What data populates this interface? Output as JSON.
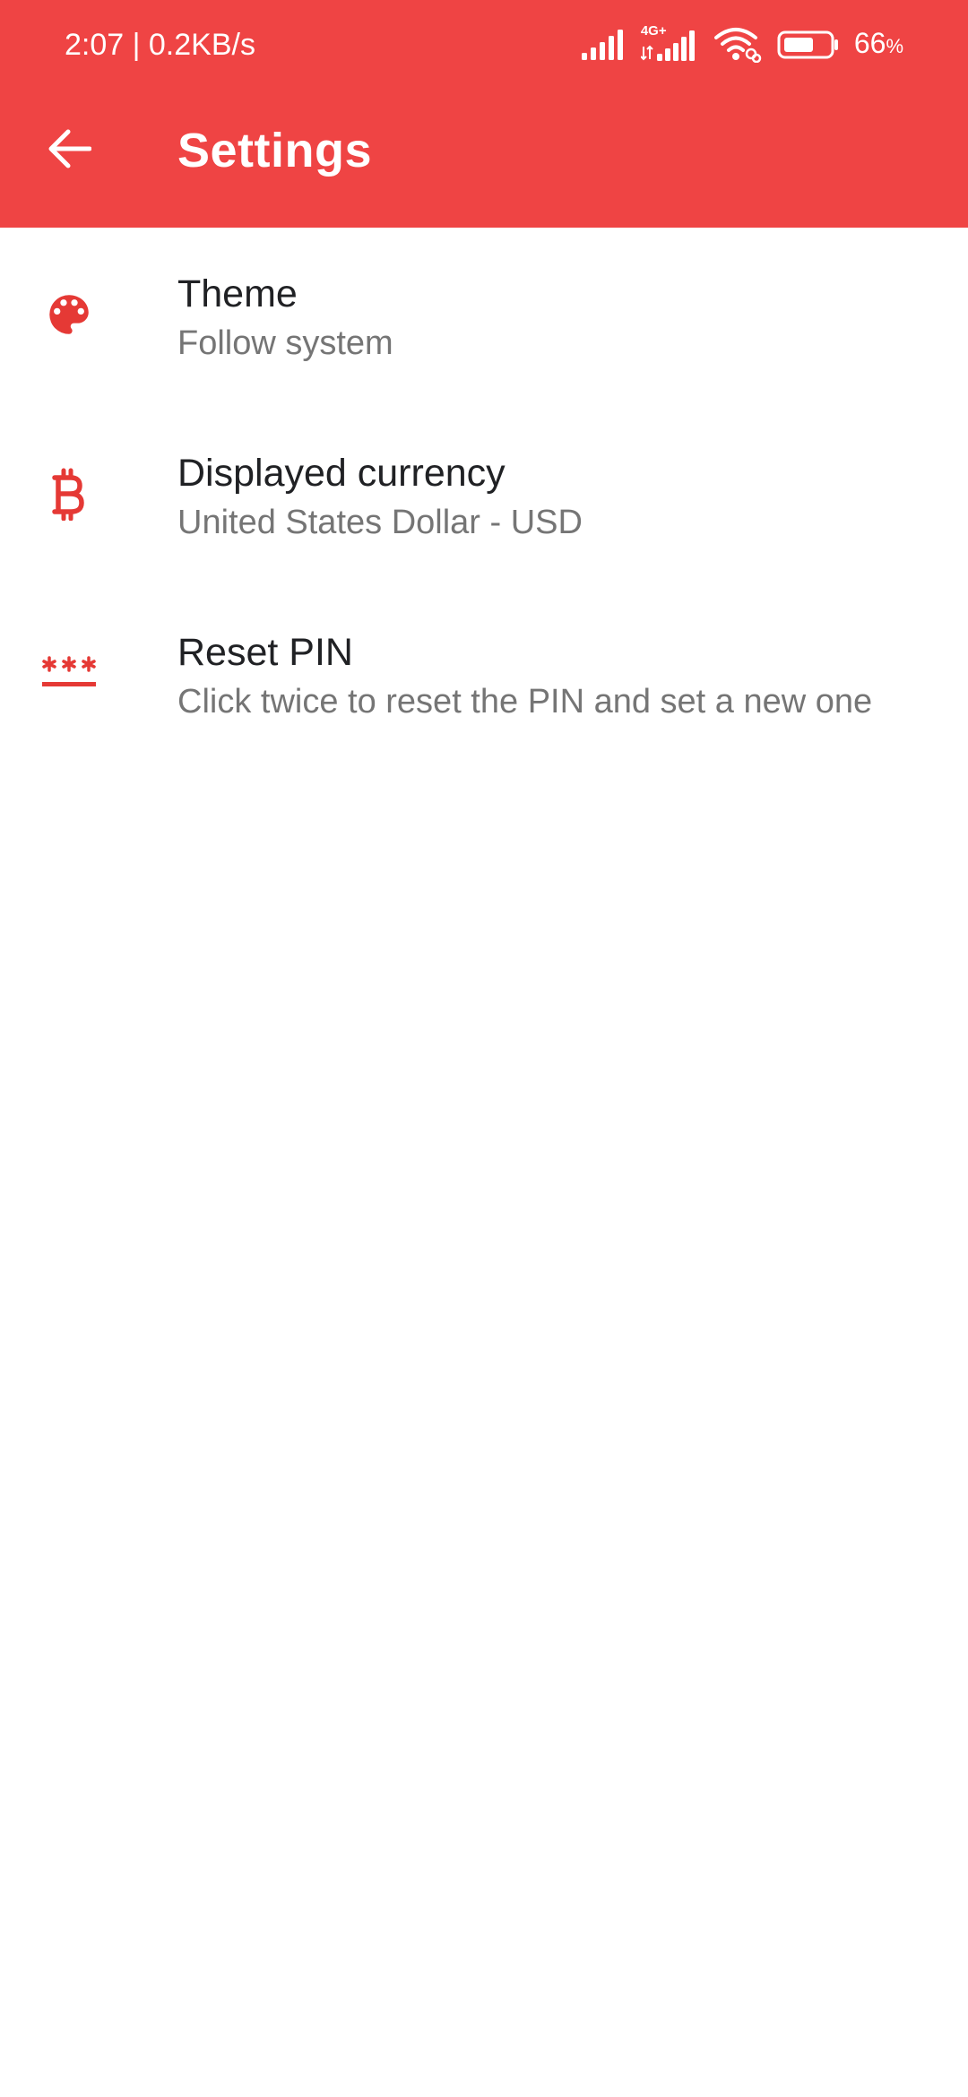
{
  "status_bar": {
    "time_speed": "2:07 | 0.2KB/s",
    "network_type": "4G+",
    "battery_level": 66,
    "battery_number": "66",
    "battery_symbol": "%"
  },
  "header": {
    "title": "Settings",
    "back_icon": "arrow-left-icon"
  },
  "settings": [
    {
      "icon": "palette-icon",
      "title": "Theme",
      "subtitle": "Follow system"
    },
    {
      "icon": "bitcoin-icon",
      "title": "Displayed currency",
      "subtitle": "United States Dollar - USD"
    },
    {
      "icon": "pin-password-icon",
      "title": "Reset PIN",
      "subtitle": "Click twice to reset the PIN and set a new one"
    }
  ],
  "colors": {
    "primary": "#EF4444",
    "icon_tint": "#E53935",
    "title_text": "#202124",
    "subtitle_text": "#757575"
  }
}
